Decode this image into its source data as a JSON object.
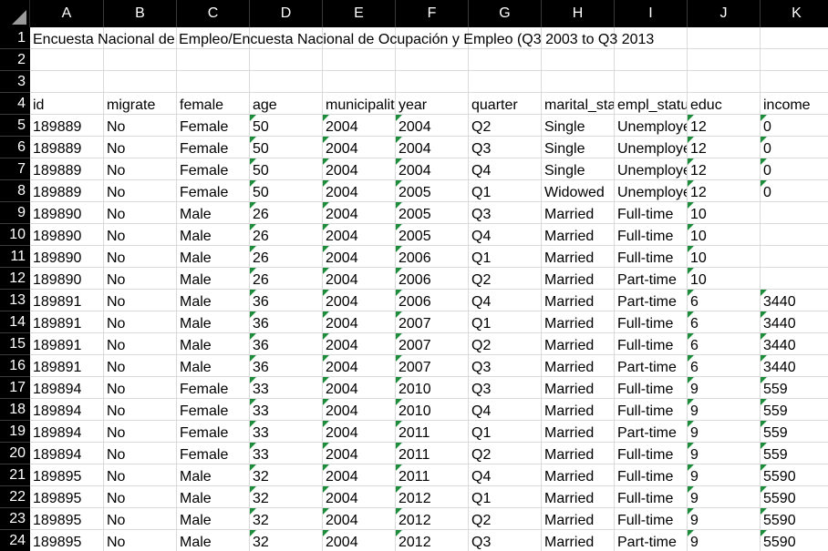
{
  "columns": [
    "A",
    "B",
    "C",
    "D",
    "E",
    "F",
    "G",
    "H",
    "I",
    "J",
    "K"
  ],
  "row_numbers": [
    "1",
    "2",
    "3",
    "4",
    "5",
    "6",
    "7",
    "8",
    "9",
    "10",
    "11",
    "12",
    "13",
    "14",
    "15",
    "16",
    "17",
    "18",
    "19",
    "20",
    "21",
    "22",
    "23",
    "24"
  ],
  "title": "Encuesta Nacional de Empleo/Encuesta Nacional de Ocupación y Empleo (Q3 2003 to Q3 2013",
  "headers": [
    "id",
    "migrate",
    "female",
    "age",
    "municipality",
    "year",
    "quarter",
    "marital_status",
    "empl_status",
    "educ",
    "income"
  ],
  "rows": [
    [
      "189889",
      "No",
      "Female",
      "50",
      "2004",
      "2004",
      "Q2",
      "Single",
      "Unemployed",
      "12",
      "0"
    ],
    [
      "189889",
      "No",
      "Female",
      "50",
      "2004",
      "2004",
      "Q3",
      "Single",
      "Unemployed",
      "12",
      "0"
    ],
    [
      "189889",
      "No",
      "Female",
      "50",
      "2004",
      "2004",
      "Q4",
      "Single",
      "Unemployed",
      "12",
      "0"
    ],
    [
      "189889",
      "No",
      "Female",
      "50",
      "2004",
      "2005",
      "Q1",
      "Widowed",
      "Unemployed",
      "12",
      "0"
    ],
    [
      "189890",
      "No",
      "Male",
      "26",
      "2004",
      "2005",
      "Q3",
      "Married",
      "Full-time",
      "10",
      ""
    ],
    [
      "189890",
      "No",
      "Male",
      "26",
      "2004",
      "2005",
      "Q4",
      "Married",
      "Full-time",
      "10",
      ""
    ],
    [
      "189890",
      "No",
      "Male",
      "26",
      "2004",
      "2006",
      "Q1",
      "Married",
      "Full-time",
      "10",
      ""
    ],
    [
      "189890",
      "No",
      "Male",
      "26",
      "2004",
      "2006",
      "Q2",
      "Married",
      "Part-time",
      "10",
      ""
    ],
    [
      "189891",
      "No",
      "Male",
      "36",
      "2004",
      "2006",
      "Q4",
      "Married",
      "Part-time",
      "6",
      "3440"
    ],
    [
      "189891",
      "No",
      "Male",
      "36",
      "2004",
      "2007",
      "Q1",
      "Married",
      "Full-time",
      "6",
      "3440"
    ],
    [
      "189891",
      "No",
      "Male",
      "36",
      "2004",
      "2007",
      "Q2",
      "Married",
      "Full-time",
      "6",
      "3440"
    ],
    [
      "189891",
      "No",
      "Male",
      "36",
      "2004",
      "2007",
      "Q3",
      "Married",
      "Part-time",
      "6",
      "3440"
    ],
    [
      "189894",
      "No",
      "Female",
      "33",
      "2004",
      "2010",
      "Q3",
      "Married",
      "Full-time",
      "9",
      "559"
    ],
    [
      "189894",
      "No",
      "Female",
      "33",
      "2004",
      "2010",
      "Q4",
      "Married",
      "Full-time",
      "9",
      "559"
    ],
    [
      "189894",
      "No",
      "Female",
      "33",
      "2004",
      "2011",
      "Q1",
      "Married",
      "Part-time",
      "9",
      "559"
    ],
    [
      "189894",
      "No",
      "Female",
      "33",
      "2004",
      "2011",
      "Q2",
      "Married",
      "Full-time",
      "9",
      "559"
    ],
    [
      "189895",
      "No",
      "Male",
      "32",
      "2004",
      "2011",
      "Q4",
      "Married",
      "Full-time",
      "9",
      "5590"
    ],
    [
      "189895",
      "No",
      "Male",
      "32",
      "2004",
      "2012",
      "Q1",
      "Married",
      "Full-time",
      "9",
      "5590"
    ],
    [
      "189895",
      "No",
      "Male",
      "32",
      "2004",
      "2012",
      "Q2",
      "Married",
      "Full-time",
      "9",
      "5590"
    ],
    [
      "189895",
      "No",
      "Male",
      "32",
      "2004",
      "2012",
      "Q3",
      "Married",
      "Part-time",
      "9",
      "5590"
    ]
  ],
  "text_number_columns": [
    3,
    4,
    5,
    9,
    10
  ],
  "indicator_color": "#1e8c3a"
}
